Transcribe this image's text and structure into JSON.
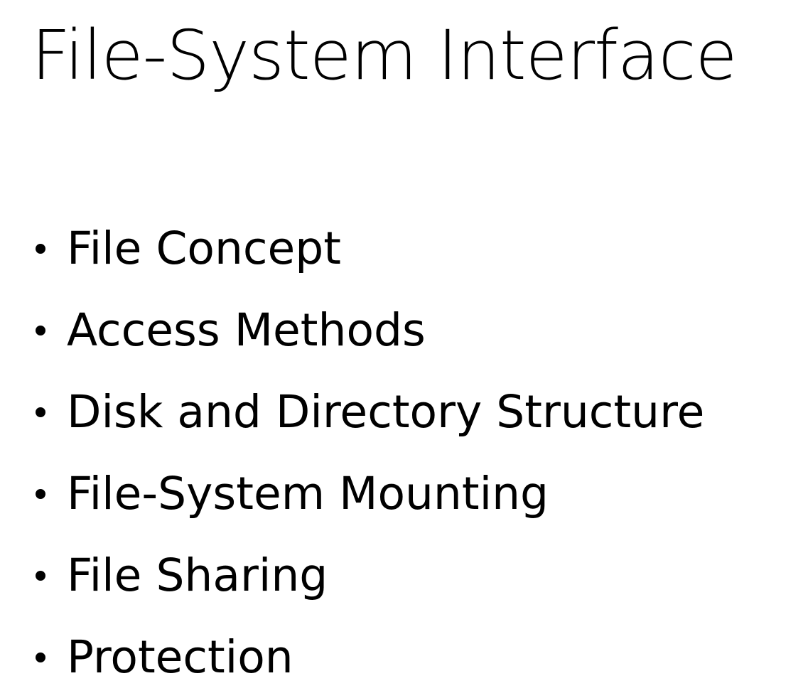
{
  "slide": {
    "title": "File-System Interface",
    "bullets": [
      "File Concept",
      "Access Methods",
      "Disk and Directory Structure",
      "File-System Mounting",
      "File Sharing",
      "Protection"
    ]
  }
}
